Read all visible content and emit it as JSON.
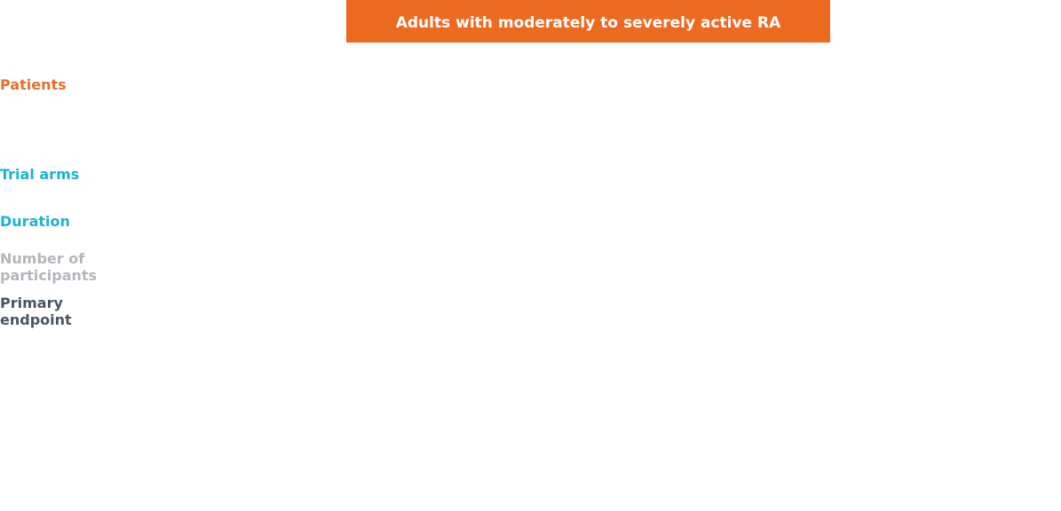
{
  "header": {
    "title": "Adults with moderately to severely active RA",
    "color": "#ED6A21"
  },
  "rows": {
    "patients": {
      "label": "Patients",
      "color": "#E8702A"
    },
    "trial_arms": {
      "label": "Trial arms",
      "color": "#1BB3D1"
    },
    "duration": {
      "label": "Duration",
      "color": "#1BB3D1"
    },
    "participants": {
      "label": "Number of participants",
      "color": "#B3B7BC"
    },
    "endpoint": {
      "label": "Primary endpoint",
      "color": "#4A5561"
    }
  }
}
